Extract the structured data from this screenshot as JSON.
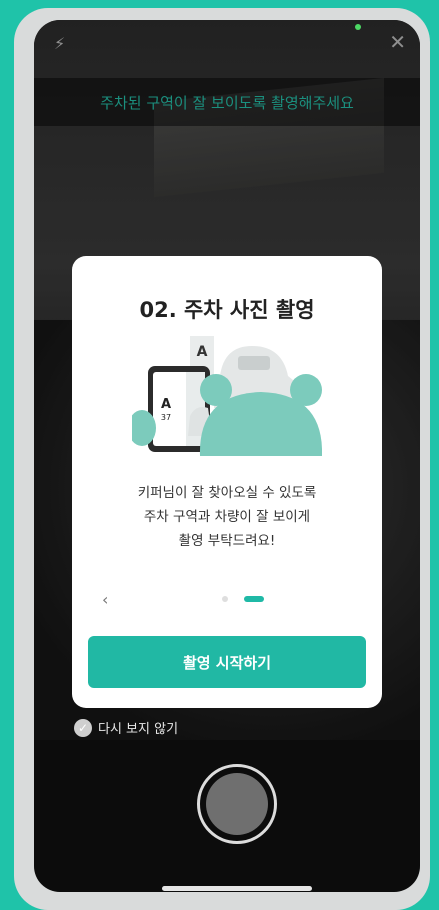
{
  "top_bar": {
    "flash_icon": "flash-off-icon",
    "close_icon": "close-icon"
  },
  "instruction": "주차된 구역이 잘 보이도록 촬영해주세요",
  "modal": {
    "title": "02. 주차 사진 촬영",
    "description_lines": [
      "키퍼님이 잘 찾아오실 수 있도록",
      "주차 구역과 차량이 잘 보이게",
      "촬영 부탁드려요!"
    ],
    "illustration_labels": [
      "A",
      "37"
    ],
    "page_indicator": {
      "current": 2,
      "total": 2
    },
    "cta_label": "촬영 시작하기"
  },
  "dont_show_again": {
    "label": "다시 보지 않기",
    "checked": true
  },
  "colors": {
    "accent": "#21b8a4",
    "background": "#1fc3a9"
  }
}
